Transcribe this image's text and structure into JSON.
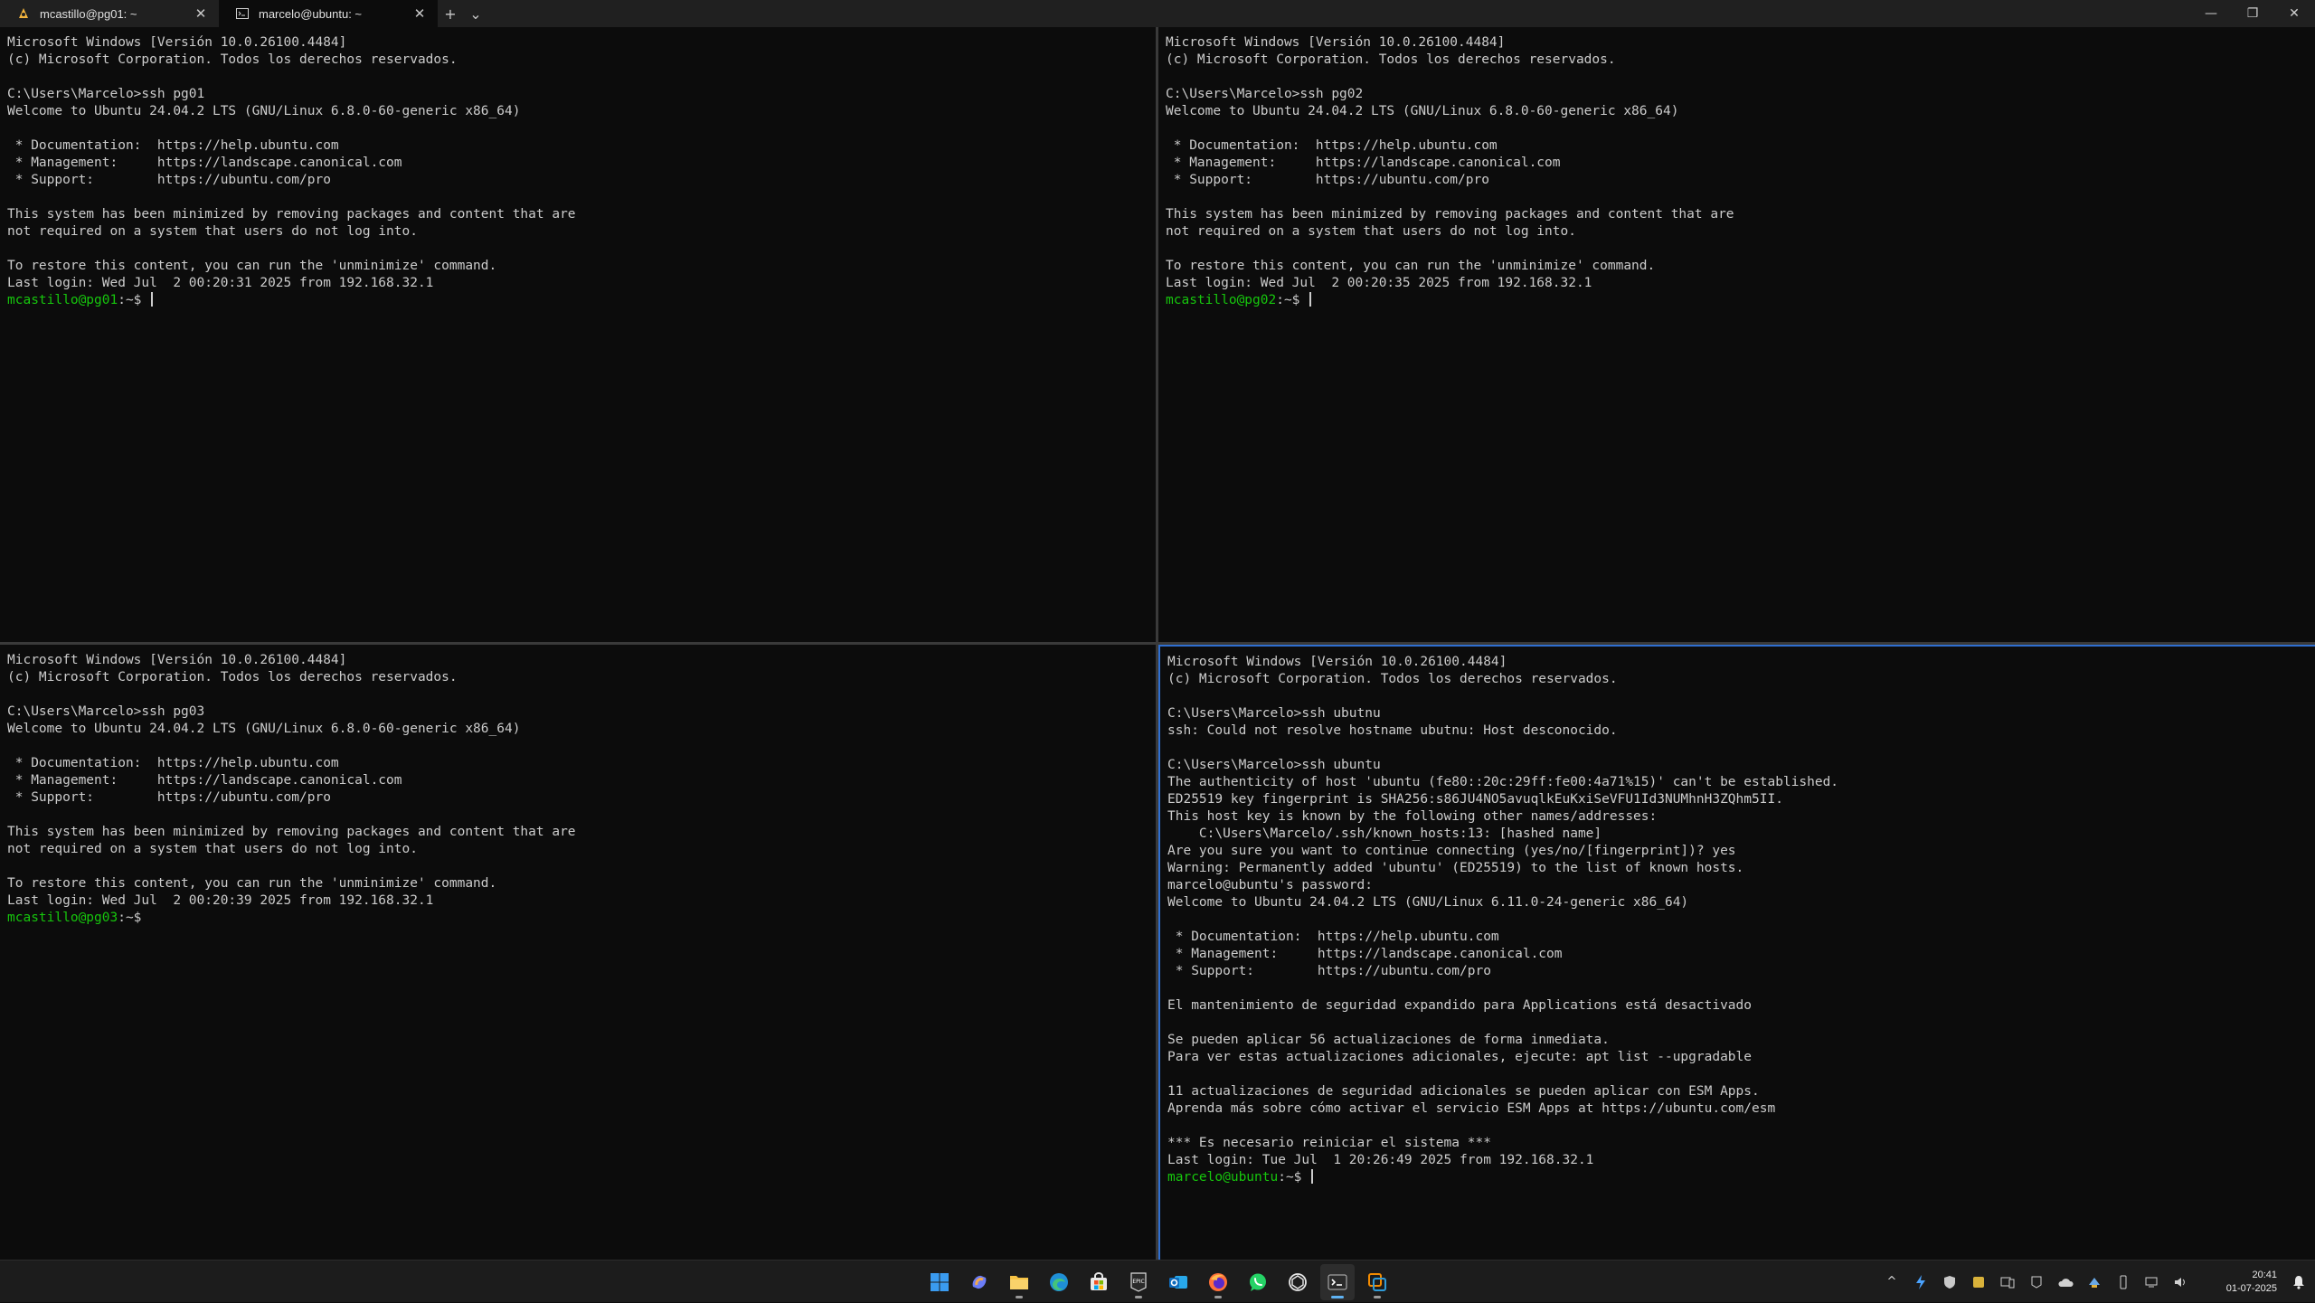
{
  "tabs": [
    {
      "label": "mcastillo@pg01: ~",
      "icon": "ubuntu-tux-icon",
      "active": false
    },
    {
      "label": "marcelo@ubuntu: ~",
      "icon": "terminal-icon",
      "active": true
    }
  ],
  "tab_buttons": {
    "new_tab": "+",
    "dropdown": "⌄"
  },
  "window_controls": {
    "minimize": "—",
    "restore": "❐",
    "close": "✕"
  },
  "panes": {
    "top_left": {
      "lines": [
        "Microsoft Windows [Versión 10.0.26100.4484]",
        "(c) Microsoft Corporation. Todos los derechos reservados.",
        "",
        "C:\\Users\\Marcelo>ssh pg01",
        "Welcome to Ubuntu 24.04.2 LTS (GNU/Linux 6.8.0-60-generic x86_64)",
        "",
        " * Documentation:  https://help.ubuntu.com",
        " * Management:     https://landscape.canonical.com",
        " * Support:        https://ubuntu.com/pro",
        "",
        "This system has been minimized by removing packages and content that are",
        "not required on a system that users do not log into.",
        "",
        "To restore this content, you can run the 'unminimize' command.",
        "Last login: Wed Jul  2 00:20:31 2025 from 192.168.32.1"
      ],
      "prompt_user": "mcastillo@pg01",
      "prompt_rest": ":~$ "
    },
    "top_right": {
      "lines": [
        "Microsoft Windows [Versión 10.0.26100.4484]",
        "(c) Microsoft Corporation. Todos los derechos reservados.",
        "",
        "C:\\Users\\Marcelo>ssh pg02",
        "Welcome to Ubuntu 24.04.2 LTS (GNU/Linux 6.8.0-60-generic x86_64)",
        "",
        " * Documentation:  https://help.ubuntu.com",
        " * Management:     https://landscape.canonical.com",
        " * Support:        https://ubuntu.com/pro",
        "",
        "This system has been minimized by removing packages and content that are",
        "not required on a system that users do not log into.",
        "",
        "To restore this content, you can run the 'unminimize' command.",
        "Last login: Wed Jul  2 00:20:35 2025 from 192.168.32.1"
      ],
      "prompt_user": "mcastillo@pg02",
      "prompt_rest": ":~$ "
    },
    "bottom_left": {
      "lines": [
        "Microsoft Windows [Versión 10.0.26100.4484]",
        "(c) Microsoft Corporation. Todos los derechos reservados.",
        "",
        "C:\\Users\\Marcelo>ssh pg03",
        "Welcome to Ubuntu 24.04.2 LTS (GNU/Linux 6.8.0-60-generic x86_64)",
        "",
        " * Documentation:  https://help.ubuntu.com",
        " * Management:     https://landscape.canonical.com",
        " * Support:        https://ubuntu.com/pro",
        "",
        "This system has been minimized by removing packages and content that are",
        "not required on a system that users do not log into.",
        "",
        "To restore this content, you can run the 'unminimize' command.",
        "Last login: Wed Jul  2 00:20:39 2025 from 192.168.32.1"
      ],
      "prompt_user": "mcastillo@pg03",
      "prompt_rest": ":~$"
    },
    "bottom_right": {
      "lines": [
        "Microsoft Windows [Versión 10.0.26100.4484]",
        "(c) Microsoft Corporation. Todos los derechos reservados.",
        "",
        "C:\\Users\\Marcelo>ssh ubutnu",
        "ssh: Could not resolve hostname ubutnu: Host desconocido.",
        "",
        "C:\\Users\\Marcelo>ssh ubuntu",
        "The authenticity of host 'ubuntu (fe80::20c:29ff:fe00:4a71%15)' can't be established.",
        "ED25519 key fingerprint is SHA256:s86JU4NO5avuqlkEuKxiSeVFU1Id3NUMhnH3ZQhm5II.",
        "This host key is known by the following other names/addresses:",
        "    C:\\Users\\Marcelo/.ssh/known_hosts:13: [hashed name]",
        "Are you sure you want to continue connecting (yes/no/[fingerprint])? yes",
        "Warning: Permanently added 'ubuntu' (ED25519) to the list of known hosts.",
        "marcelo@ubuntu's password:",
        "Welcome to Ubuntu 24.04.2 LTS (GNU/Linux 6.11.0-24-generic x86_64)",
        "",
        " * Documentation:  https://help.ubuntu.com",
        " * Management:     https://landscape.canonical.com",
        " * Support:        https://ubuntu.com/pro",
        "",
        "El mantenimiento de seguridad expandido para Applications está desactivado",
        "",
        "Se pueden aplicar 56 actualizaciones de forma inmediata.",
        "Para ver estas actualizaciones adicionales, ejecute: apt list --upgradable",
        "",
        "11 actualizaciones de seguridad adicionales se pueden aplicar con ESM Apps.",
        "Aprenda más sobre cómo activar el servicio ESM Apps at https://ubuntu.com/esm",
        "",
        "*** Es necesario reiniciar el sistema ***",
        "Last login: Tue Jul  1 20:26:49 2025 from 192.168.32.1"
      ],
      "prompt_user": "marcelo@ubuntu",
      "prompt_rest": ":~$ "
    }
  },
  "taskbar": {
    "apps": [
      {
        "name": "start-icon",
        "active": false,
        "running": false
      },
      {
        "name": "copilot-icon",
        "active": false,
        "running": false
      },
      {
        "name": "file-explorer-icon",
        "active": false,
        "running": true
      },
      {
        "name": "edge-icon",
        "active": false,
        "running": false
      },
      {
        "name": "store-icon",
        "active": false,
        "running": false
      },
      {
        "name": "epic-games-icon",
        "active": false,
        "running": true
      },
      {
        "name": "outlook-icon",
        "active": false,
        "running": false
      },
      {
        "name": "firefox-icon",
        "active": false,
        "running": true
      },
      {
        "name": "whatsapp-icon",
        "active": false,
        "running": false
      },
      {
        "name": "chatgpt-icon",
        "active": false,
        "running": false
      },
      {
        "name": "terminal-icon",
        "active": true,
        "running": true
      },
      {
        "name": "vmware-icon",
        "active": false,
        "running": true
      }
    ],
    "tray": {
      "chevron": "^",
      "clock_time": "20:41",
      "clock_date": "01-07-2025"
    }
  },
  "colors": {
    "prompt_green": "#16c60c",
    "active_pane_border": "#2f6fd1",
    "terminal_bg": "#0c0c0c",
    "terminal_fg": "#cccccc"
  }
}
